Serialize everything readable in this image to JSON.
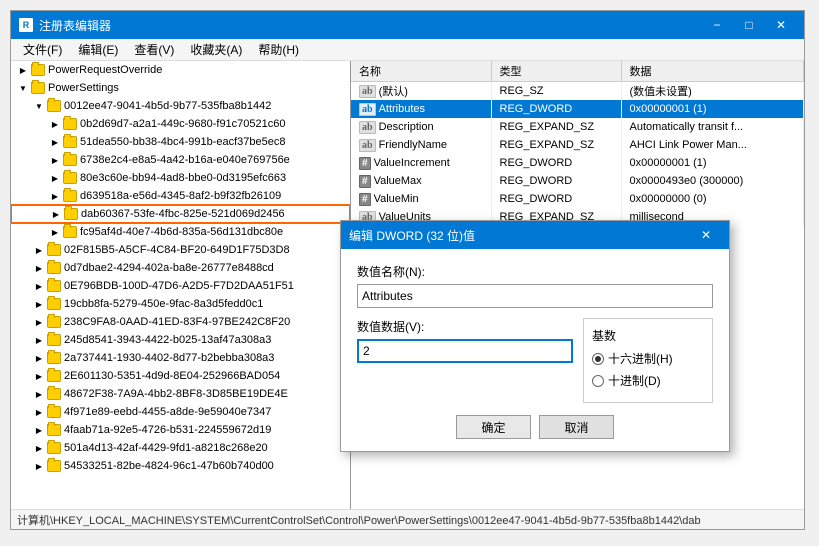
{
  "window": {
    "title": "注册表编辑器",
    "menu": [
      "文件(F)",
      "编辑(E)",
      "查看(V)",
      "收藏夹(A)",
      "帮助(H)"
    ]
  },
  "tree": {
    "items": [
      {
        "id": "PowerRequestOverride",
        "label": "PowerRequestOverride",
        "level": 1,
        "expanded": false,
        "selected": false
      },
      {
        "id": "PowerSettings",
        "label": "PowerSettings",
        "level": 1,
        "expanded": true,
        "selected": false
      },
      {
        "id": "0012ee47",
        "label": "0012ee47-9041-4b5d-9b77-535fba8b1442",
        "level": 2,
        "expanded": true,
        "selected": false
      },
      {
        "id": "0b2d69d7",
        "label": "0b2d69d7-a2a1-449c-9680-f91c70521c60",
        "level": 3,
        "selected": false
      },
      {
        "id": "51dea550",
        "label": "51dea550-bb38-4bc4-991b-eacf37be5ec8",
        "level": 3,
        "selected": false
      },
      {
        "id": "6738e2c4",
        "label": "6738e2c4-e8a5-4a42-b16a-e040e769756e",
        "level": 3,
        "selected": false
      },
      {
        "id": "80e3c60e",
        "label": "80e3c60e-bb94-4ad8-bbe0-0d3195efc663",
        "level": 3,
        "selected": false
      },
      {
        "id": "d639518a",
        "label": "d639518a-e56d-4345-8af2-b9f32fb26109",
        "level": 3,
        "selected": false
      },
      {
        "id": "dab60367",
        "label": "dab60367-53fe-4fbc-825e-521d069d2456",
        "level": 3,
        "selected": true,
        "highlighted": true
      },
      {
        "id": "fc95af4d",
        "label": "fc95af4d-40e7-4b6d-835a-56d131dbc80e",
        "level": 3,
        "selected": false
      },
      {
        "id": "02F815B5",
        "label": "02F815B5-A5CF-4C84-BF20-649D1F75D3D8",
        "level": 2,
        "selected": false
      },
      {
        "id": "0d7dbae2",
        "label": "0d7dbae2-4294-402a-ba8e-26777e8488cd",
        "level": 2,
        "selected": false
      },
      {
        "id": "0E796BDB",
        "label": "0E796BDB-100D-47D6-A2D5-F7D2DAA51F51",
        "level": 2,
        "selected": false
      },
      {
        "id": "19cbb8fa",
        "label": "19cbb8fa-5279-450e-9fac-8a3d5fedd0c1",
        "level": 2,
        "selected": false
      },
      {
        "id": "238C9FA8",
        "label": "238C9FA8-0AAD-41ED-83F4-97BE242C8F20",
        "level": 2,
        "selected": false
      },
      {
        "id": "245d8541",
        "label": "245d8541-3943-4422-b025-13af47a308a3",
        "level": 2,
        "selected": false
      },
      {
        "id": "2a737441",
        "label": "2a737441-1930-4402-8d77-b2bebba308a3",
        "level": 2,
        "selected": false
      },
      {
        "id": "2E601130",
        "label": "2E601130-5351-4d9d-8E04-252966BAD054",
        "level": 2,
        "selected": false
      },
      {
        "id": "48672F38",
        "label": "48672F38-7A9A-4bb2-8BF8-3D85BE19DE4E",
        "level": 2,
        "selected": false
      },
      {
        "id": "4f971e89",
        "label": "4f971e89-eebd-4455-a8de-9e59040e7347",
        "level": 2,
        "selected": false
      },
      {
        "id": "4faab71a",
        "label": "4faab71a-92e5-4726-b531-224559672d19",
        "level": 2,
        "selected": false
      },
      {
        "id": "501a4d13",
        "label": "501a4d13-42af-4429-9fd1-a8218c268e20",
        "level": 2,
        "selected": false
      },
      {
        "id": "54533251",
        "label": "54533251-82be-4824-96c1-47b60b740d00",
        "level": 2,
        "selected": false
      }
    ]
  },
  "registry_table": {
    "columns": [
      "名称",
      "类型",
      "数据"
    ],
    "rows": [
      {
        "name": "(默认)",
        "icon": "ab",
        "type": "REG_SZ",
        "data": "(数值未设置)",
        "selected": false
      },
      {
        "name": "Attributes",
        "icon": "ab",
        "type": "REG_DWORD",
        "data": "0x00000001 (1)",
        "selected": true
      },
      {
        "name": "Description",
        "icon": "ab",
        "type": "REG_EXPAND_SZ",
        "data": "Automatically transit f...",
        "selected": false
      },
      {
        "name": "FriendlyName",
        "icon": "ab",
        "type": "REG_EXPAND_SZ",
        "data": "AHCI Link Power Man...",
        "selected": false
      },
      {
        "name": "ValueIncrement",
        "icon": "val",
        "type": "REG_DWORD",
        "data": "0x00000001 (1)",
        "selected": false
      },
      {
        "name": "ValueMax",
        "icon": "val",
        "type": "REG_DWORD",
        "data": "0x0000493e0 (300000)",
        "selected": false
      },
      {
        "name": "ValueMin",
        "icon": "val",
        "type": "REG_DWORD",
        "data": "0x00000000 (0)",
        "selected": false
      },
      {
        "name": "ValueUnits",
        "icon": "ab",
        "type": "REG_EXPAND_SZ",
        "data": "millisecond",
        "selected": false
      }
    ]
  },
  "dialog": {
    "title": "编辑 DWORD (32 位)值",
    "value_name_label": "数值名称(N):",
    "value_name": "Attributes",
    "value_data_label": "数值数据(V):",
    "value_data": "2",
    "base_label": "基数",
    "base_options": [
      {
        "label": "十六进制(H)",
        "value": "hex",
        "checked": true
      },
      {
        "label": "十进制(D)",
        "value": "dec",
        "checked": false
      }
    ],
    "ok_label": "确定",
    "cancel_label": "取消"
  },
  "status_bar": {
    "text": "计算机\\HKEY_LOCAL_MACHINE\\SYSTEM\\CurrentControlSet\\Control\\Power\\PowerSettings\\0012ee47-9041-4b5d-9b77-535fba8b1442\\dab"
  }
}
